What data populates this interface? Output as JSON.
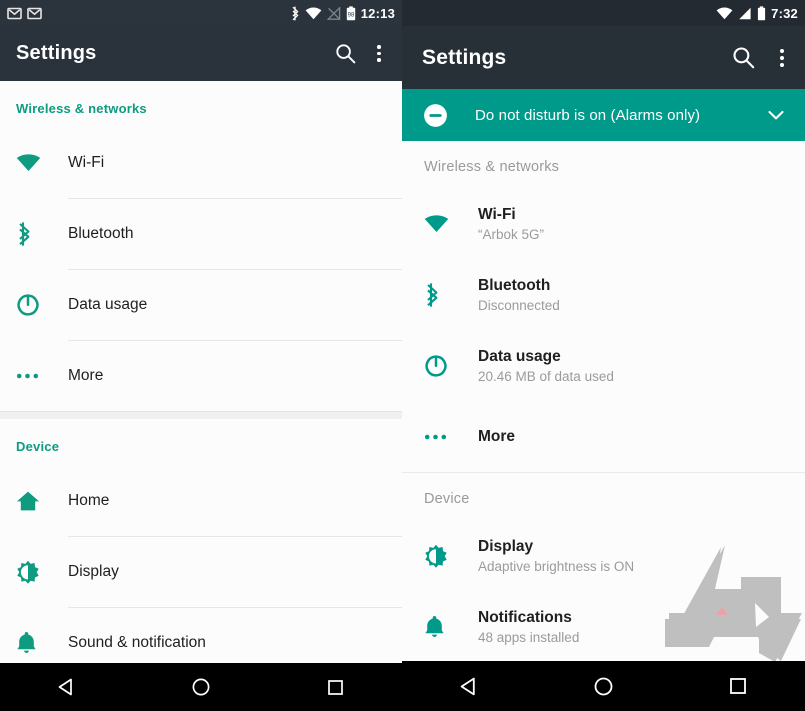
{
  "colors": {
    "teal_accent": "#0f9b80",
    "teal_banner": "#009a8b",
    "appbar_left": "#2a333c",
    "appbar_right": "#272f37",
    "statusbar_left": "#2b343d",
    "statusbar_right": "#232a31",
    "list_bg": "#fcfcfc",
    "title_text": "#1f1f1f",
    "subtitle_text": "#9b9b9b",
    "section_head_right": "#9a9a9a",
    "navbar": "#000000",
    "watermark_gray": "#a8a8a8",
    "watermark_red": "#e8808a"
  },
  "left_screen": {
    "statusbar": {
      "notification_icons": [
        "gmail-icon",
        "gmail-icon"
      ],
      "system_icons": [
        "bluetooth-icon",
        "wifi-icon",
        "cell-signal-off-icon",
        "battery-icon"
      ],
      "battery_level": "98",
      "clock": "12:13"
    },
    "appbar": {
      "title": "Settings",
      "search_label": "Search",
      "overflow_label": "More options"
    },
    "sections": [
      {
        "heading": "Wireless & networks",
        "items": [
          {
            "icon": "wifi-icon",
            "title": "Wi-Fi",
            "subtitle": ""
          },
          {
            "icon": "bluetooth-icon",
            "title": "Bluetooth",
            "subtitle": ""
          },
          {
            "icon": "data-usage-icon",
            "title": "Data usage",
            "subtitle": ""
          },
          {
            "icon": "more-dots-icon",
            "title": "More",
            "subtitle": ""
          }
        ]
      },
      {
        "heading": "Device",
        "items": [
          {
            "icon": "home-icon",
            "title": "Home",
            "subtitle": ""
          },
          {
            "icon": "brightness-icon",
            "title": "Display",
            "subtitle": ""
          },
          {
            "icon": "bell-icon",
            "title": "Sound & notification",
            "subtitle": ""
          }
        ]
      }
    ],
    "navbar": {
      "back": "back-icon",
      "home": "home-circle-icon",
      "recents": "recents-square-icon"
    }
  },
  "right_screen": {
    "statusbar": {
      "notification_icons": [],
      "system_icons": [
        "wifi-icon",
        "cell-signal-icon",
        "battery-icon"
      ],
      "clock": "7:32"
    },
    "appbar": {
      "title": "Settings",
      "search_label": "Search",
      "overflow_label": "More options"
    },
    "dnd_banner": {
      "icon": "do-not-disturb-icon",
      "text": "Do not disturb is on (Alarms only)",
      "expand_icon": "chevron-down-icon"
    },
    "sections": [
      {
        "heading": "Wireless & networks",
        "items": [
          {
            "icon": "wifi-icon",
            "title": "Wi-Fi",
            "subtitle": "“Arbok 5G”"
          },
          {
            "icon": "bluetooth-icon",
            "title": "Bluetooth",
            "subtitle": "Disconnected"
          },
          {
            "icon": "data-usage-icon",
            "title": "Data usage",
            "subtitle": "20.46 MB of data used"
          },
          {
            "icon": "more-dots-icon",
            "title": "More",
            "subtitle": ""
          }
        ]
      },
      {
        "heading": "Device",
        "items": [
          {
            "icon": "brightness-icon",
            "title": "Display",
            "subtitle": "Adaptive brightness is ON"
          },
          {
            "icon": "bell-icon",
            "title": "Notifications",
            "subtitle": "48 apps installed"
          }
        ]
      }
    ],
    "watermark": {
      "name": "android-police-logo-watermark"
    },
    "navbar": {
      "back": "back-icon",
      "home": "home-circle-icon",
      "recents": "recents-square-icon"
    }
  }
}
